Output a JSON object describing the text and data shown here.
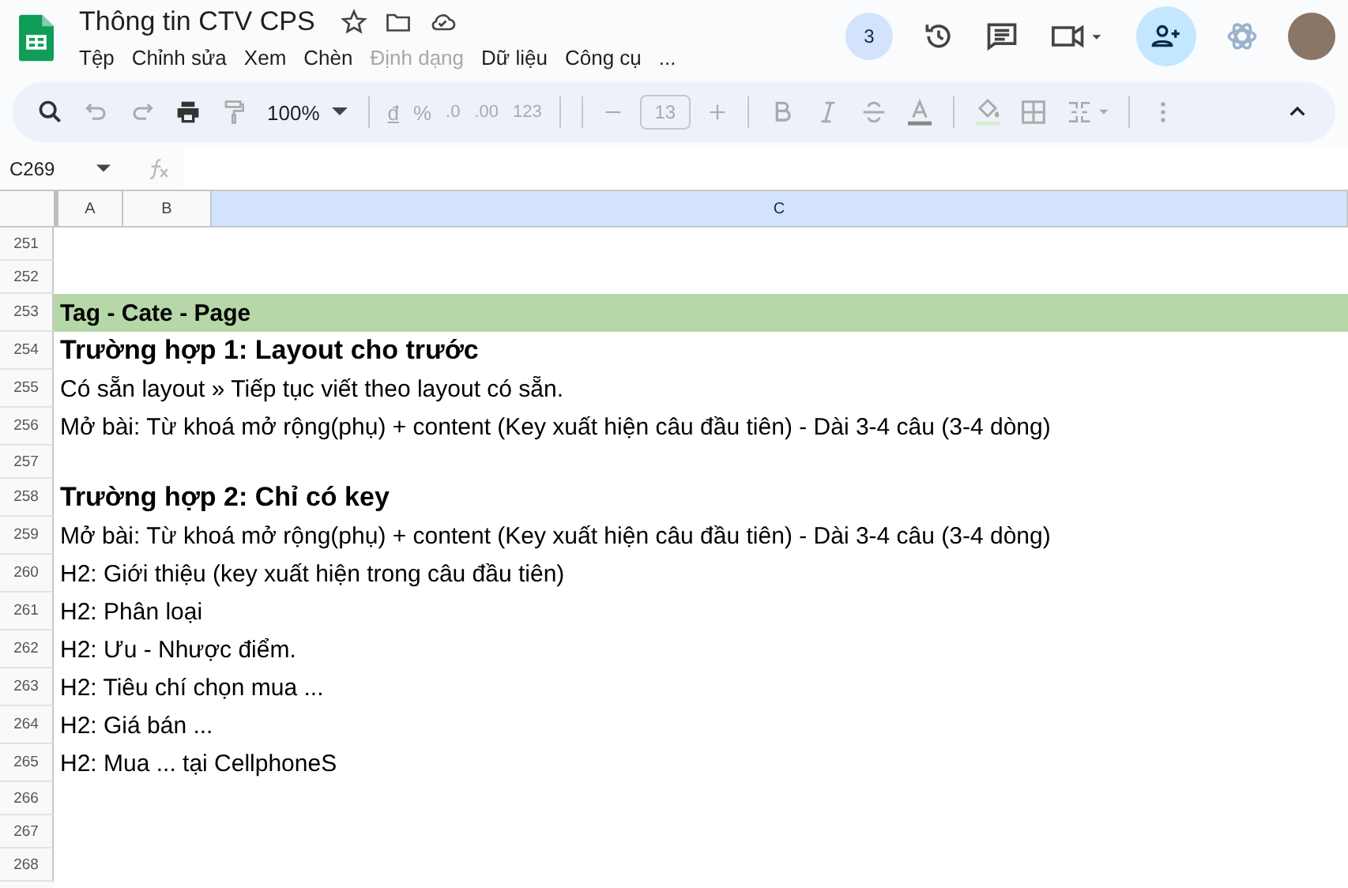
{
  "document": {
    "title": "Thông tin CTV CPS"
  },
  "menu": [
    {
      "label": "Tệp",
      "disabled": false
    },
    {
      "label": "Chỉnh sửa",
      "disabled": false
    },
    {
      "label": "Xem",
      "disabled": false
    },
    {
      "label": "Chèn",
      "disabled": false
    },
    {
      "label": "Định dạng",
      "disabled": true
    },
    {
      "label": "Dữ liệu",
      "disabled": false
    },
    {
      "label": "Công cụ",
      "disabled": false
    },
    {
      "label": "...",
      "disabled": false
    }
  ],
  "header_actions": {
    "viewer_count": "3"
  },
  "toolbar": {
    "zoom": "100%",
    "currency": "đ",
    "percent": "%",
    "decrease_decimal": ".0",
    "increase_decimal": ".00",
    "number_format": "123",
    "font_size": "13"
  },
  "name_box": "C269",
  "columns": [
    {
      "label": "A",
      "selected": false
    },
    {
      "label": "B",
      "selected": false
    },
    {
      "label": "C",
      "selected": true
    }
  ],
  "rows": [
    {
      "number": "251",
      "kind": "empty"
    },
    {
      "number": "252",
      "kind": "empty"
    },
    {
      "number": "253",
      "kind": "section",
      "text": "Tag - Cate - Page"
    },
    {
      "number": "254",
      "kind": "heading",
      "text": "Trường hợp 1: Layout cho trước"
    },
    {
      "number": "255",
      "kind": "text",
      "text": "Có sẵn layout » Tiếp tục viết theo layout có sẵn."
    },
    {
      "number": "256",
      "kind": "text",
      "text": "Mở bài: Từ khoá mở rộng(phụ) + content (Key xuất hiện câu đầu tiên) - Dài 3-4 câu (3-4 dòng)"
    },
    {
      "number": "257",
      "kind": "empty"
    },
    {
      "number": "258",
      "kind": "heading",
      "text": "Trường hợp 2: Chỉ có key"
    },
    {
      "number": "259",
      "kind": "text",
      "text": "Mở bài: Từ khoá mở rộng(phụ) + content (Key xuất hiện câu đầu tiên) - Dài 3-4 câu (3-4 dòng)"
    },
    {
      "number": "260",
      "kind": "text",
      "text": "H2: Giới thiệu (key xuất hiện trong câu đầu tiên)"
    },
    {
      "number": "261",
      "kind": "text",
      "text": "H2: Phân loại"
    },
    {
      "number": "262",
      "kind": "text",
      "text": "H2: Ưu - Nhược điểm."
    },
    {
      "number": "263",
      "kind": "text",
      "text": "H2: Tiêu chí chọn mua ..."
    },
    {
      "number": "264",
      "kind": "text",
      "text": "H2: Giá bán ..."
    },
    {
      "number": "265",
      "kind": "text",
      "text": "H2: Mua ... tại CellphoneS"
    },
    {
      "number": "266",
      "kind": "empty"
    },
    {
      "number": "267",
      "kind": "empty"
    },
    {
      "number": "268",
      "kind": "empty"
    }
  ]
}
